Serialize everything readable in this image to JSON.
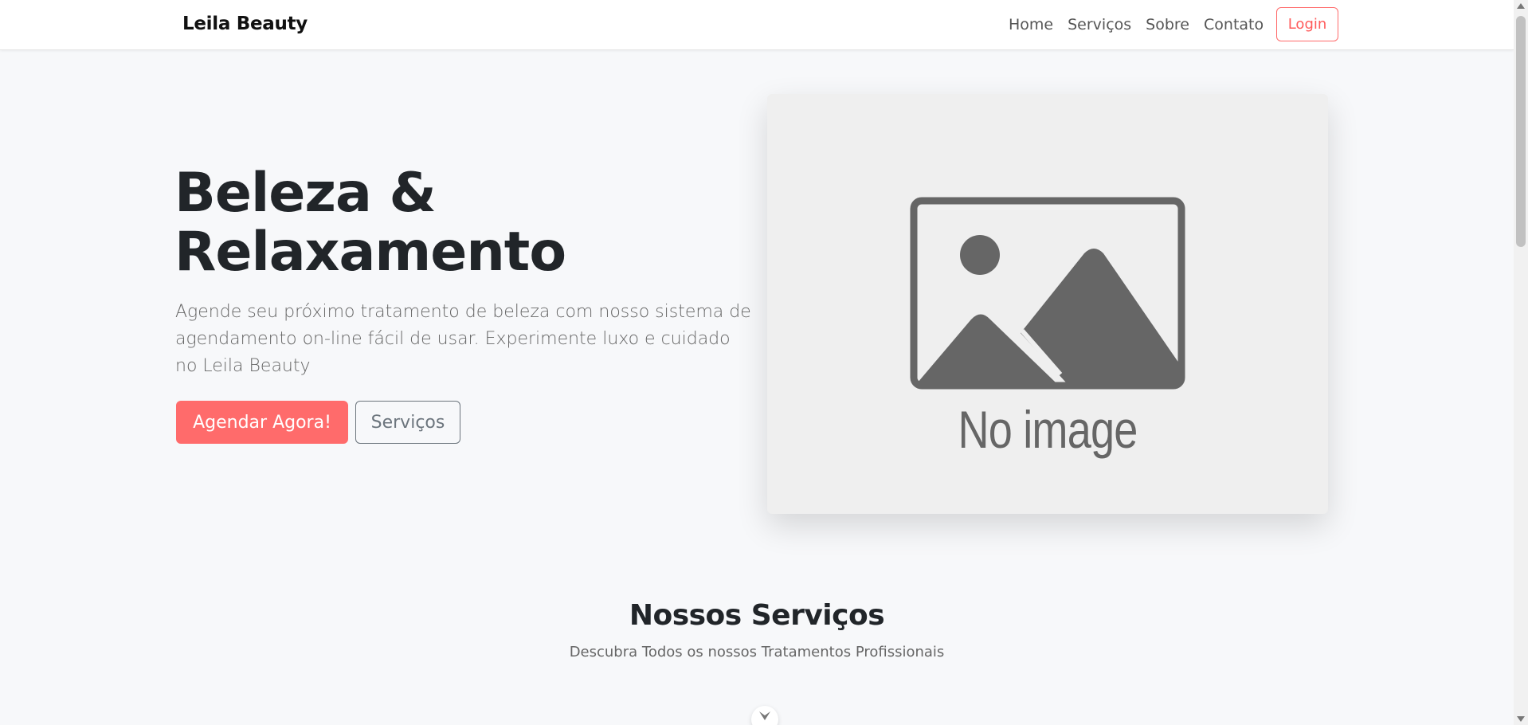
{
  "navbar": {
    "brand": "Leila Beauty",
    "links": [
      "Home",
      "Serviços",
      "Sobre",
      "Contato"
    ],
    "login_label": "Login"
  },
  "hero": {
    "title_line1": "Beleza &",
    "title_line2": "Relaxamento",
    "description": "Agende seu próximo tratamento de beleza com nosso sistema de agendamento on-line fácil de usar. Experimente luxo e cuidado no Leila Beauty",
    "primary_button": "Agendar Agora!",
    "secondary_button": "Serviços",
    "image_placeholder_text": "No image"
  },
  "services_section": {
    "title": "Nossos Serviços",
    "subtitle": "Descubra Todos os nossos Tratamentos Profissionais"
  },
  "colors": {
    "accent": "#ff6b6b",
    "background": "#f7f8fa",
    "text_dark": "#212529",
    "text_muted": "#666666"
  },
  "icons": {
    "scroll_down": "chevron-down-icon",
    "placeholder": "image-placeholder-icon"
  }
}
